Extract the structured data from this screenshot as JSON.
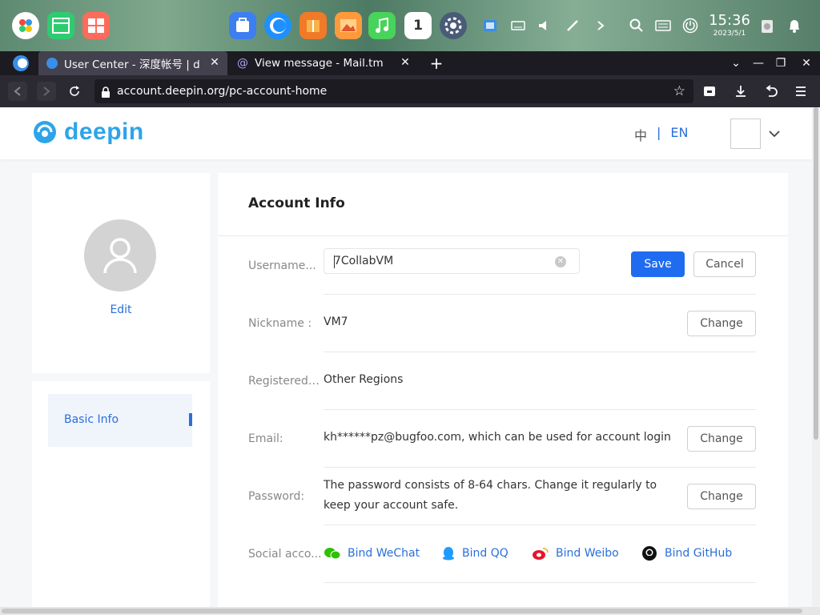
{
  "taskbar": {
    "time": "15:36",
    "date": "2023/5/1",
    "calendar_day": "1"
  },
  "browser": {
    "tabs": [
      {
        "title": "User Center - 深度帐号 | d"
      },
      {
        "title": "View message - Mail.tm"
      }
    ],
    "url": "account.deepin.org/pc-account-home"
  },
  "header": {
    "logo_text": "deepin",
    "lang_zh": "中",
    "lang_sep": "|",
    "lang_en": "EN"
  },
  "sidebar": {
    "edit_label": "Edit",
    "menu_item": "Basic Info"
  },
  "account": {
    "title": "Account Info",
    "username": {
      "label": "Username...",
      "value": "7CollabVM",
      "save": "Save",
      "cancel": "Cancel"
    },
    "nickname": {
      "label": "Nickname :",
      "value": "VM7",
      "button": "Change"
    },
    "registered": {
      "label": "Registered ...",
      "value": "Other Regions"
    },
    "email": {
      "label": "Email:",
      "value": "kh******pz@bugfoo.com, which can be used for account login",
      "button": "Change"
    },
    "password": {
      "label": "Password:",
      "line1": "The password consists of 8-64 chars. Change it regularly to",
      "line2": "keep your account safe.",
      "button": "Change"
    },
    "social": {
      "label": "Social acco...",
      "wechat": "Bind WeChat",
      "qq": "Bind QQ",
      "weibo": "Bind Weibo",
      "github": "Bind GitHub"
    }
  },
  "colors": {
    "accent": "#1f6cf0",
    "link": "#2a6fdb",
    "dock": "#5e8a72"
  }
}
